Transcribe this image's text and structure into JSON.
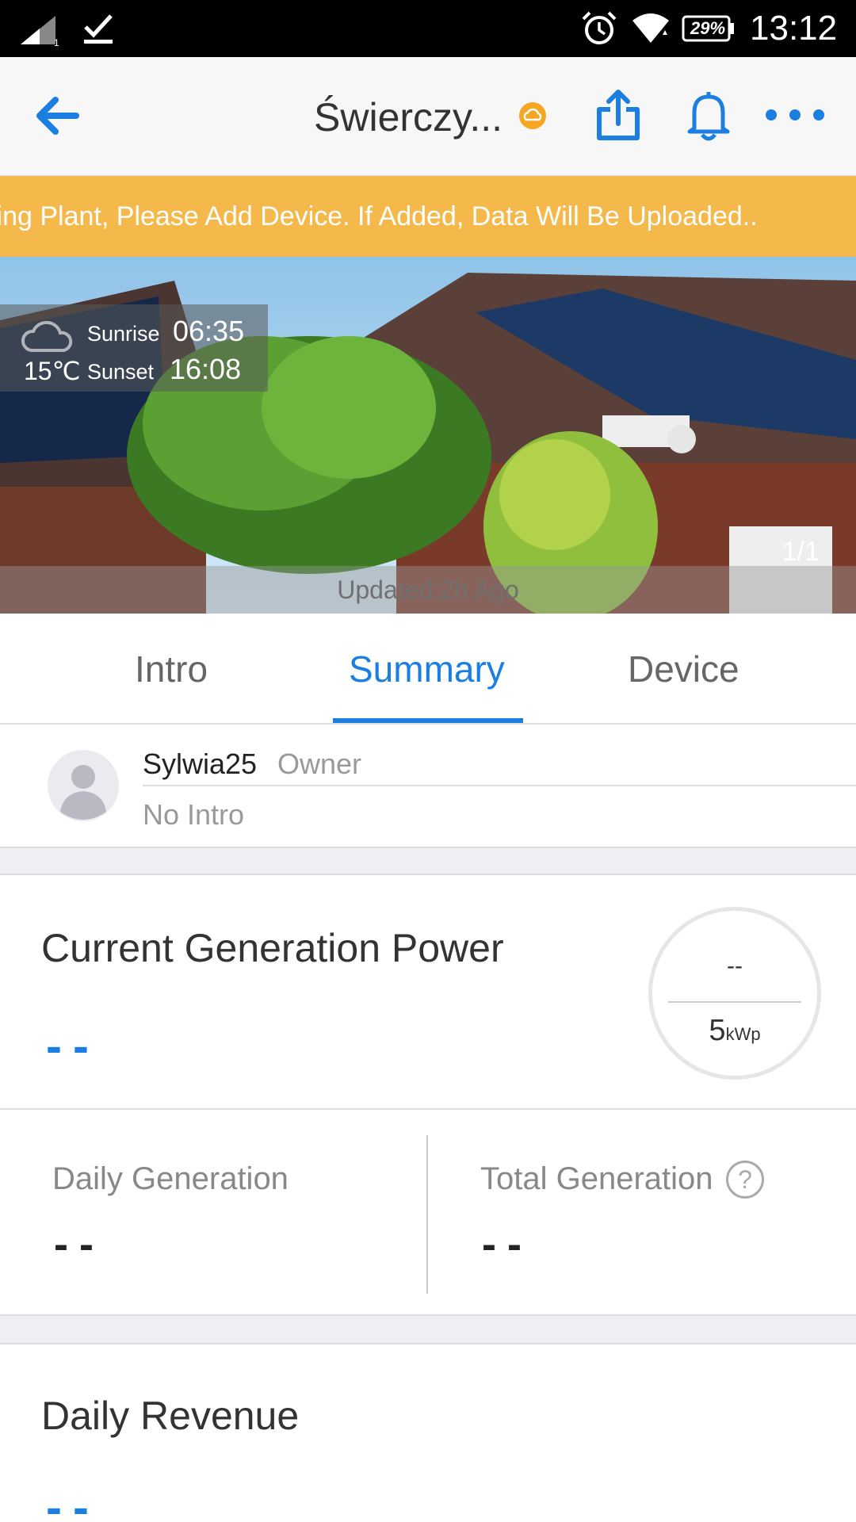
{
  "status_bar": {
    "battery": "29%",
    "time": "13:12",
    "icons": [
      "signal-icon",
      "download-done-icon",
      "alarm-icon",
      "wifi-icon",
      "battery-icon"
    ]
  },
  "header": {
    "title": "Świerczy...",
    "status_icon": "cloud-status-icon",
    "status_color": "#f5a623",
    "accent_color": "#1a7fe0",
    "icons": [
      "back-arrow-icon",
      "share-icon",
      "bell-icon",
      "more-icon"
    ]
  },
  "banner": {
    "text": "ling Plant, Please Add Device. If Added, Data Will Be Uploaded..",
    "color": "#f5b84a"
  },
  "hero": {
    "temperature": "15℃",
    "sunrise_label": "Sunrise",
    "sunrise_time": "06:35",
    "sunset_label": "Sunset",
    "sunset_time": "16:08",
    "counter": "1/1",
    "updated": "Updated:2h Ago"
  },
  "tabs": [
    {
      "label": "Intro",
      "active": false
    },
    {
      "label": "Summary",
      "active": true
    },
    {
      "label": "Device",
      "active": false
    }
  ],
  "owner": {
    "name": "Sylwia25",
    "role": "Owner",
    "intro": "No Intro"
  },
  "power": {
    "label": "Current Generation Power",
    "value": "--",
    "gauge_value": "--",
    "capacity_number": "5",
    "capacity_unit": "kWp"
  },
  "stats": {
    "daily_label": "Daily Generation",
    "daily_value": "--",
    "total_label": "Total Generation",
    "total_value": "--",
    "help_glyph": "?"
  },
  "revenue": {
    "label": "Daily Revenue",
    "value": "--"
  }
}
